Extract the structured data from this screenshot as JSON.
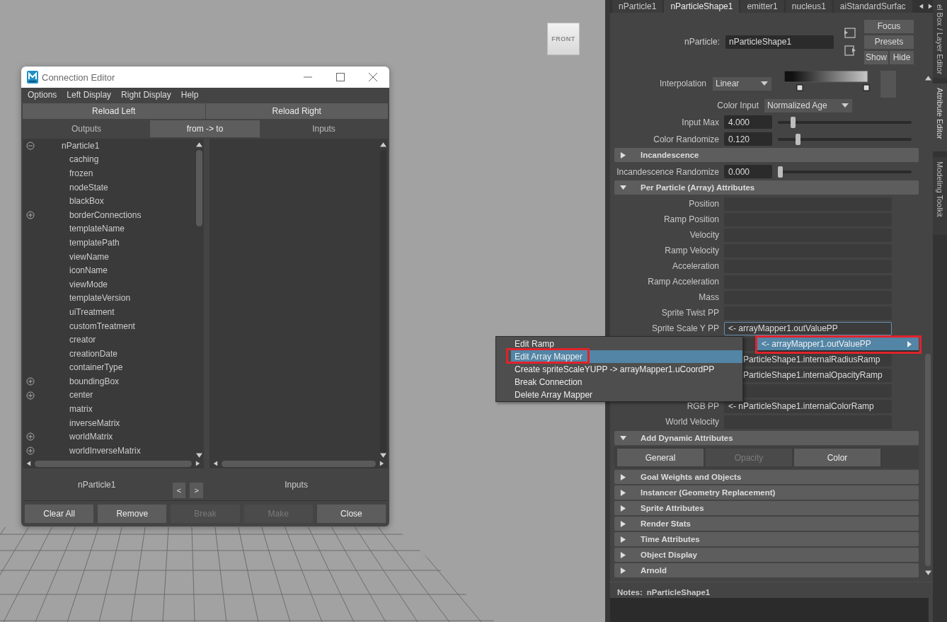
{
  "viewport": {
    "view_cube": "FRONT"
  },
  "connection_editor": {
    "title": "Connection Editor",
    "menu": [
      "Options",
      "Left Display",
      "Right Display",
      "Help"
    ],
    "reload_buttons": [
      "Reload Left",
      "Reload Right"
    ],
    "headers": [
      {
        "label": "Outputs",
        "selected": false
      },
      {
        "label": "from -> to",
        "selected": true
      },
      {
        "label": "Inputs",
        "selected": false
      }
    ],
    "tree": [
      {
        "label": "nParticle1",
        "expanded": true,
        "children": [
          {
            "label": "caching"
          },
          {
            "label": "frozen"
          },
          {
            "label": "nodeState"
          },
          {
            "label": "blackBox"
          },
          {
            "label": "borderConnections",
            "expanded": false
          },
          {
            "label": "templateName"
          },
          {
            "label": "templatePath"
          },
          {
            "label": "viewName"
          },
          {
            "label": "iconName"
          },
          {
            "label": "viewMode"
          },
          {
            "label": "templateVersion"
          },
          {
            "label": "uiTreatment"
          },
          {
            "label": "customTreatment"
          },
          {
            "label": "creator"
          },
          {
            "label": "creationDate"
          },
          {
            "label": "containerType"
          },
          {
            "label": "boundingBox",
            "expanded": false
          },
          {
            "label": "center",
            "expanded": false
          },
          {
            "label": "matrix"
          },
          {
            "label": "inverseMatrix"
          },
          {
            "label": "worldMatrix",
            "expanded": false
          },
          {
            "label": "worldInverseMatrix",
            "expanded": false
          }
        ]
      }
    ],
    "left_node": "nParticle1",
    "arrows": [
      "<",
      ">"
    ],
    "right_label": "Inputs",
    "buttons": [
      {
        "label": "Clear All",
        "disabled": false
      },
      {
        "label": "Remove",
        "disabled": false
      },
      {
        "label": "Break",
        "disabled": true
      },
      {
        "label": "Make",
        "disabled": true
      },
      {
        "label": "Close",
        "disabled": false
      }
    ]
  },
  "attribute_editor": {
    "tabs": [
      {
        "label": "nParticle1",
        "selected": false
      },
      {
        "label": "nParticleShape1",
        "selected": true
      },
      {
        "label": "emitter1",
        "selected": false
      },
      {
        "label": "nucleus1",
        "selected": false
      },
      {
        "label": "aiStandardSurfac",
        "selected": false
      }
    ],
    "node_label": "nParticle:",
    "node_name": "nParticleShape1",
    "header_buttons": [
      "Focus",
      "Presets",
      "Show",
      "Hide"
    ],
    "ramp": {
      "label": "Interpolation",
      "value": "Linear"
    },
    "body": [
      {
        "kind": "dropdown",
        "label": "Color Input",
        "value": "Normalized Age"
      },
      {
        "kind": "slider",
        "label": "Input Max",
        "value": "4.000",
        "level": 0.1
      },
      {
        "kind": "slider",
        "label": "Color Randomize",
        "value": "0.120",
        "level": 0.14
      },
      {
        "kind": "section",
        "title": "Incandescence",
        "expanded": false
      },
      {
        "kind": "slider",
        "label": "Incandescence Randomize",
        "value": "0.000",
        "level": 0
      },
      {
        "kind": "section",
        "title": "Per Particle (Array) Attributes",
        "expanded": true
      },
      {
        "kind": "field",
        "label": "Position"
      },
      {
        "kind": "field",
        "label": "Ramp Position"
      },
      {
        "kind": "field",
        "label": "Velocity"
      },
      {
        "kind": "field",
        "label": "Ramp Velocity"
      },
      {
        "kind": "field",
        "label": "Acceleration"
      },
      {
        "kind": "field",
        "label": "Ramp Acceleration"
      },
      {
        "kind": "field",
        "label": "Mass"
      },
      {
        "kind": "field",
        "label": "Sprite Twist PP"
      },
      {
        "kind": "field",
        "label": "Sprite Scale Y PP",
        "value": "<- arrayMapper1.outValuePP",
        "focused": true
      },
      {
        "kind": "field"
      },
      {
        "kind": "field",
        "value": "ParticleShape1.internalRadiusRamp"
      },
      {
        "kind": "field",
        "value": "ParticleShape1.internalOpacityRamp"
      },
      {
        "kind": "field"
      },
      {
        "kind": "field",
        "label": "RGB PP",
        "value": "<- nParticleShape1.internalColorRamp"
      },
      {
        "kind": "field",
        "label": "World Velocity"
      },
      {
        "kind": "section",
        "title": "Add Dynamic Attributes",
        "expanded": true
      },
      {
        "kind": "buttons",
        "buttons": [
          {
            "label": "General",
            "disabled": false
          },
          {
            "label": "Opacity",
            "disabled": true
          },
          {
            "label": "Color",
            "disabled": false
          }
        ]
      },
      {
        "kind": "section",
        "title": "Goal Weights and Objects",
        "expanded": false
      },
      {
        "kind": "section",
        "title": "Instancer (Geometry Replacement)",
        "expanded": false
      },
      {
        "kind": "section",
        "title": "Sprite Attributes",
        "expanded": false
      },
      {
        "kind": "section",
        "title": "Render Stats",
        "expanded": false
      },
      {
        "kind": "section",
        "title": "Time Attributes",
        "expanded": false
      },
      {
        "kind": "section",
        "title": "Object Display",
        "expanded": false
      },
      {
        "kind": "section",
        "title": "Arnold",
        "expanded": false
      }
    ],
    "notes_label": "Notes:",
    "notes_node": "nParticleShape1"
  },
  "side_tabs": [
    {
      "label": "el Box / Layer Editor",
      "selected": false
    },
    {
      "label": "Attribute Editor",
      "selected": true
    },
    {
      "label": "Modeling Toolkit",
      "selected": false
    }
  ],
  "context_menu": {
    "items": [
      {
        "label": "Edit Ramp",
        "selected": false,
        "annotated": false
      },
      {
        "label": "Edit Array Mapper",
        "selected": true,
        "annotated": true
      },
      {
        "label": "Create spriteScaleYUPP -> arrayMapper1.uCoordPP",
        "selected": false,
        "annotated": false
      },
      {
        "label": "Break Connection",
        "selected": false,
        "annotated": false
      },
      {
        "label": "Delete Array Mapper",
        "selected": false,
        "annotated": false
      }
    ],
    "submenu": {
      "label": "<- arrayMapper1.outValuePP",
      "selected": true,
      "annotated": true
    }
  }
}
